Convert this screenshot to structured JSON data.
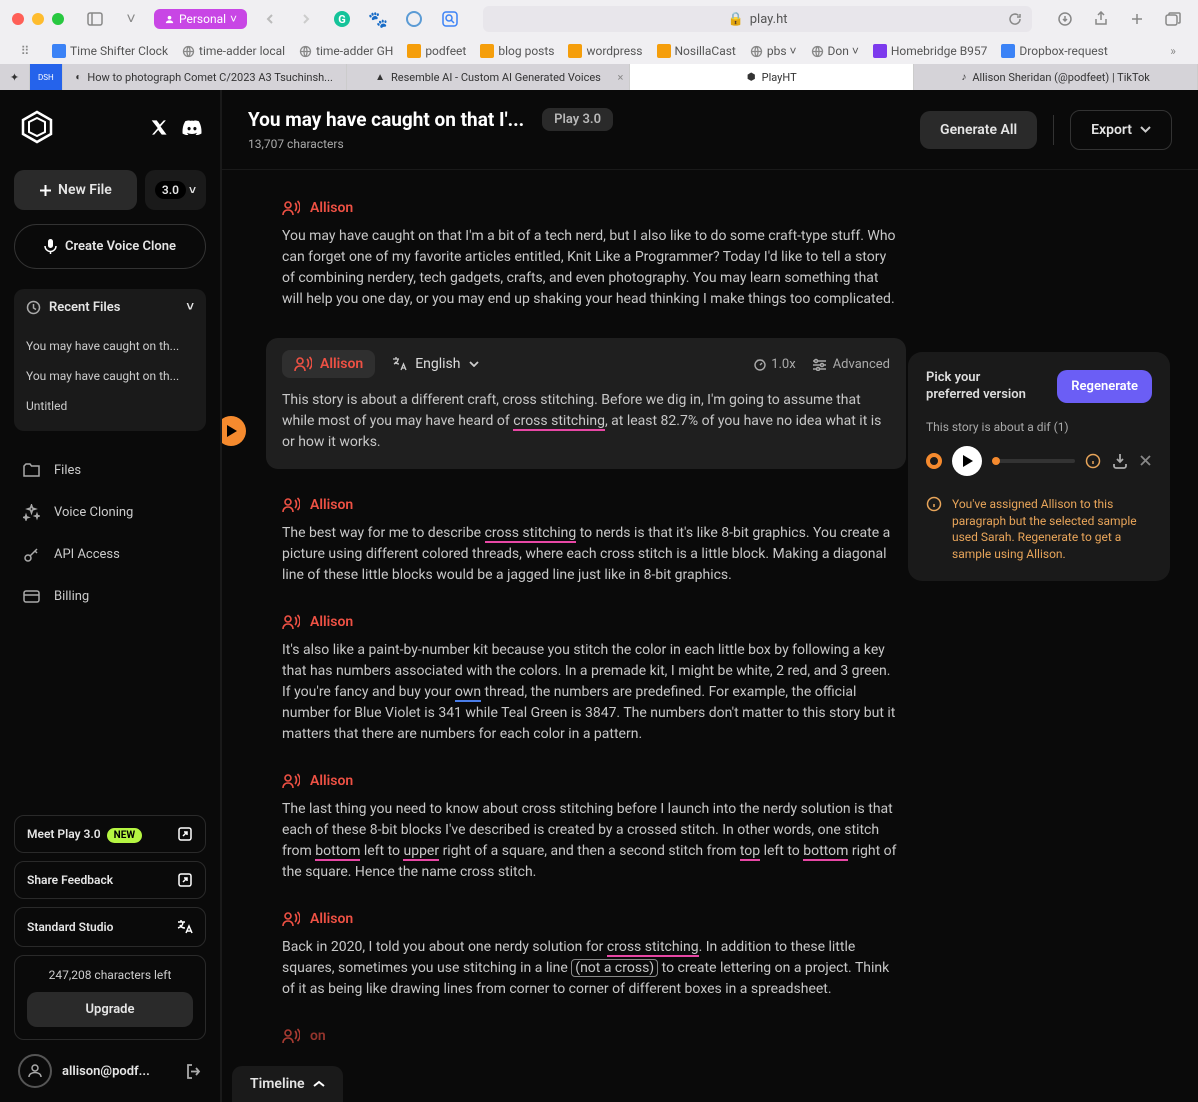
{
  "browser": {
    "url": "play.ht",
    "personal": "Personal",
    "bookmarks": [
      {
        "label": "Time Shifter Clock",
        "color": "#3b82f6"
      },
      {
        "label": "time-adder local",
        "color": "#888"
      },
      {
        "label": "time-adder GH",
        "color": "#888"
      },
      {
        "label": "podfeet",
        "color": "#f59e0b"
      },
      {
        "label": "blog posts",
        "color": "#f59e0b"
      },
      {
        "label": "wordpress",
        "color": "#f59e0b"
      },
      {
        "label": "NosillaCast",
        "color": "#f59e0b"
      },
      {
        "label": "pbs ˅",
        "color": "#888"
      },
      {
        "label": "Don ˅",
        "color": "#888"
      },
      {
        "label": "Homebridge B957",
        "color": "#7c3aed"
      },
      {
        "label": "Dropbox-request",
        "color": "#3b82f6"
      }
    ],
    "tabs": [
      {
        "label": "How to photograph Comet C/2023 A3 Tsuchinsh...",
        "active": false
      },
      {
        "label": "Resemble AI - Custom AI Generated Voices",
        "active": false,
        "closeable": true
      },
      {
        "label": "PlayHT",
        "active": true
      },
      {
        "label": "Allison Sheridan (@podfeet) | TikTok",
        "active": false
      }
    ]
  },
  "sidebar": {
    "newFile": "New File",
    "version": "3.0",
    "voiceClone": "Create Voice Clone",
    "recentHeader": "Recent Files",
    "recentFiles": [
      "You may have caught on th...",
      "You may have caught on th...",
      "Untitled"
    ],
    "nav": [
      {
        "label": "Files",
        "icon": "folder"
      },
      {
        "label": "Voice Cloning",
        "icon": "sparkles"
      },
      {
        "label": "API Access",
        "icon": "key"
      },
      {
        "label": "Billing",
        "icon": "card"
      }
    ],
    "meetPlay": "Meet Play 3.0",
    "newBadge": "NEW",
    "feedback": "Share Feedback",
    "studio": "Standard Studio",
    "charsLeft": "247,208 characters left",
    "upgrade": "Upgrade",
    "userEmail": "allison@podf..."
  },
  "header": {
    "title": "You may have caught on that I'...",
    "playBadge": "Play 3.0",
    "charCount": "13,707 characters",
    "generateAll": "Generate All",
    "export": "Export"
  },
  "paragraphs": [
    {
      "speaker": "Allison",
      "text": "You may have caught on that I'm a bit of a tech nerd, but I also like to do some craft-type stuff. Who can forget one of my favorite articles entitled, Knit Like a Programmer? Today I'd like to tell a story of combining nerdery, tech gadgets, crafts, and even photography. You may learn something that will help you one day, or you may end up shaking your head thinking I make things too complicated."
    },
    {
      "speaker": "Allison",
      "editing": true,
      "language": "English",
      "speed": "1.0x",
      "advanced": "Advanced",
      "textParts": [
        {
          "t": "This story is about a different craft, cross stitching. Before we dig in, I'm going to assume that while most of you may have heard of "
        },
        {
          "t": "cross stitching",
          "u": "pink"
        },
        {
          "t": ", at least 82.7% of you have no idea what it is or how it works."
        }
      ]
    },
    {
      "speaker": "Allison",
      "textParts": [
        {
          "t": "The best way for me to describe "
        },
        {
          "t": "cross stitching",
          "u": "pink"
        },
        {
          "t": " to nerds is that it's like 8-bit graphics. You create a picture using different colored threads, where each cross stitch is a little block. Making a diagonal line of these little blocks would be a jagged line just like in 8-bit graphics."
        }
      ]
    },
    {
      "speaker": "Allison",
      "textParts": [
        {
          "t": "It's also like a paint-by-number kit because you stitch the color in each little box by following a key that has numbers associated with the colors.  In a premade kit, I might be white, 2 red, and 3 green.  If you're fancy and buy your "
        },
        {
          "t": "own",
          "u": "blue"
        },
        {
          "t": " thread, the numbers are predefined. For example, the official number for Blue Violet is 341 while Teal Green is 3847. The numbers don't matter to this story but it matters that there are numbers for each color in a pattern."
        }
      ]
    },
    {
      "speaker": "Allison",
      "textParts": [
        {
          "t": "The last thing you need to know about cross stitching before I launch into the nerdy solution is that each of these 8-bit blocks I've described is created by a crossed stitch. In other words, one stitch from "
        },
        {
          "t": "bottom",
          "u": "pink"
        },
        {
          "t": " left to "
        },
        {
          "t": "upper",
          "u": "pink"
        },
        {
          "t": " right of a square, and then a second stitch from "
        },
        {
          "t": "top",
          "u": "pink"
        },
        {
          "t": " left to "
        },
        {
          "t": "bottom",
          "u": "pink"
        },
        {
          "t": " right of the square. Hence the name cross stitch."
        }
      ]
    },
    {
      "speaker": "Allison",
      "textParts": [
        {
          "t": "Back in 2020, I told you about one nerdy solution for "
        },
        {
          "t": "cross stitching",
          "u": "pink"
        },
        {
          "t": ". In addition to these little squares, sometimes you use stitching in a line "
        },
        {
          "t": "(not a cross)",
          "u": "box"
        },
        {
          "t": " to create lettering on a project. Think of it as being like drawing lines from corner to corner of different boxes in a spreadsheet."
        }
      ]
    },
    {
      "speaker": "Allison",
      "text": "",
      "cut": true
    }
  ],
  "regen": {
    "title": "Pick your preferred version",
    "button": "Regenerate",
    "subtitle": "This story is about a dif (1)",
    "warning": "You've assigned Allison to this paragraph but the selected sample used Sarah. Regenerate to get a sample using Allison."
  },
  "timeline": "Timeline"
}
